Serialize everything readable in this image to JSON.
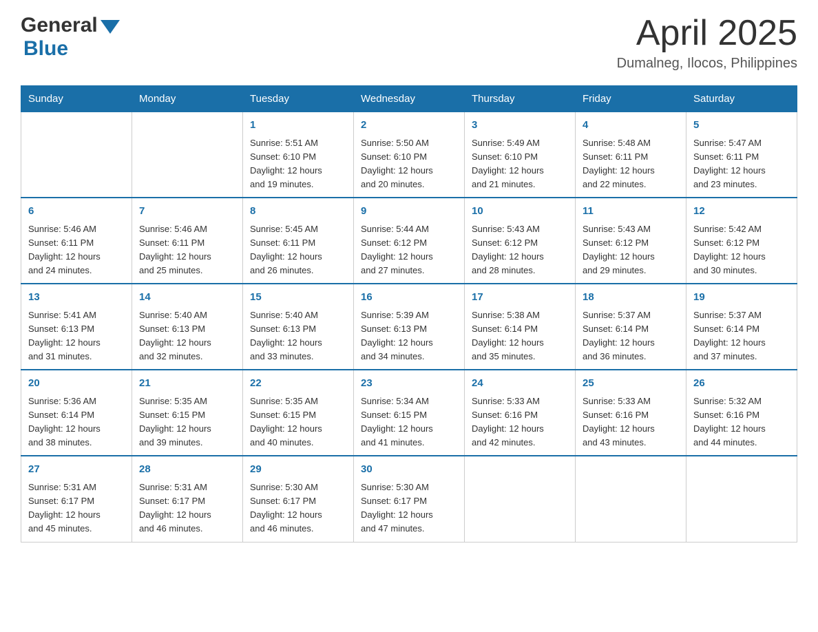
{
  "logo": {
    "part1": "General",
    "part2": "Blue"
  },
  "title": "April 2025",
  "subtitle": "Dumalneg, Ilocos, Philippines",
  "days_of_week": [
    "Sunday",
    "Monday",
    "Tuesday",
    "Wednesday",
    "Thursday",
    "Friday",
    "Saturday"
  ],
  "weeks": [
    [
      {
        "day": "",
        "info": ""
      },
      {
        "day": "",
        "info": ""
      },
      {
        "day": "1",
        "info": "Sunrise: 5:51 AM\nSunset: 6:10 PM\nDaylight: 12 hours\nand 19 minutes."
      },
      {
        "day": "2",
        "info": "Sunrise: 5:50 AM\nSunset: 6:10 PM\nDaylight: 12 hours\nand 20 minutes."
      },
      {
        "day": "3",
        "info": "Sunrise: 5:49 AM\nSunset: 6:10 PM\nDaylight: 12 hours\nand 21 minutes."
      },
      {
        "day": "4",
        "info": "Sunrise: 5:48 AM\nSunset: 6:11 PM\nDaylight: 12 hours\nand 22 minutes."
      },
      {
        "day": "5",
        "info": "Sunrise: 5:47 AM\nSunset: 6:11 PM\nDaylight: 12 hours\nand 23 minutes."
      }
    ],
    [
      {
        "day": "6",
        "info": "Sunrise: 5:46 AM\nSunset: 6:11 PM\nDaylight: 12 hours\nand 24 minutes."
      },
      {
        "day": "7",
        "info": "Sunrise: 5:46 AM\nSunset: 6:11 PM\nDaylight: 12 hours\nand 25 minutes."
      },
      {
        "day": "8",
        "info": "Sunrise: 5:45 AM\nSunset: 6:11 PM\nDaylight: 12 hours\nand 26 minutes."
      },
      {
        "day": "9",
        "info": "Sunrise: 5:44 AM\nSunset: 6:12 PM\nDaylight: 12 hours\nand 27 minutes."
      },
      {
        "day": "10",
        "info": "Sunrise: 5:43 AM\nSunset: 6:12 PM\nDaylight: 12 hours\nand 28 minutes."
      },
      {
        "day": "11",
        "info": "Sunrise: 5:43 AM\nSunset: 6:12 PM\nDaylight: 12 hours\nand 29 minutes."
      },
      {
        "day": "12",
        "info": "Sunrise: 5:42 AM\nSunset: 6:12 PM\nDaylight: 12 hours\nand 30 minutes."
      }
    ],
    [
      {
        "day": "13",
        "info": "Sunrise: 5:41 AM\nSunset: 6:13 PM\nDaylight: 12 hours\nand 31 minutes."
      },
      {
        "day": "14",
        "info": "Sunrise: 5:40 AM\nSunset: 6:13 PM\nDaylight: 12 hours\nand 32 minutes."
      },
      {
        "day": "15",
        "info": "Sunrise: 5:40 AM\nSunset: 6:13 PM\nDaylight: 12 hours\nand 33 minutes."
      },
      {
        "day": "16",
        "info": "Sunrise: 5:39 AM\nSunset: 6:13 PM\nDaylight: 12 hours\nand 34 minutes."
      },
      {
        "day": "17",
        "info": "Sunrise: 5:38 AM\nSunset: 6:14 PM\nDaylight: 12 hours\nand 35 minutes."
      },
      {
        "day": "18",
        "info": "Sunrise: 5:37 AM\nSunset: 6:14 PM\nDaylight: 12 hours\nand 36 minutes."
      },
      {
        "day": "19",
        "info": "Sunrise: 5:37 AM\nSunset: 6:14 PM\nDaylight: 12 hours\nand 37 minutes."
      }
    ],
    [
      {
        "day": "20",
        "info": "Sunrise: 5:36 AM\nSunset: 6:14 PM\nDaylight: 12 hours\nand 38 minutes."
      },
      {
        "day": "21",
        "info": "Sunrise: 5:35 AM\nSunset: 6:15 PM\nDaylight: 12 hours\nand 39 minutes."
      },
      {
        "day": "22",
        "info": "Sunrise: 5:35 AM\nSunset: 6:15 PM\nDaylight: 12 hours\nand 40 minutes."
      },
      {
        "day": "23",
        "info": "Sunrise: 5:34 AM\nSunset: 6:15 PM\nDaylight: 12 hours\nand 41 minutes."
      },
      {
        "day": "24",
        "info": "Sunrise: 5:33 AM\nSunset: 6:16 PM\nDaylight: 12 hours\nand 42 minutes."
      },
      {
        "day": "25",
        "info": "Sunrise: 5:33 AM\nSunset: 6:16 PM\nDaylight: 12 hours\nand 43 minutes."
      },
      {
        "day": "26",
        "info": "Sunrise: 5:32 AM\nSunset: 6:16 PM\nDaylight: 12 hours\nand 44 minutes."
      }
    ],
    [
      {
        "day": "27",
        "info": "Sunrise: 5:31 AM\nSunset: 6:17 PM\nDaylight: 12 hours\nand 45 minutes."
      },
      {
        "day": "28",
        "info": "Sunrise: 5:31 AM\nSunset: 6:17 PM\nDaylight: 12 hours\nand 46 minutes."
      },
      {
        "day": "29",
        "info": "Sunrise: 5:30 AM\nSunset: 6:17 PM\nDaylight: 12 hours\nand 46 minutes."
      },
      {
        "day": "30",
        "info": "Sunrise: 5:30 AM\nSunset: 6:17 PM\nDaylight: 12 hours\nand 47 minutes."
      },
      {
        "day": "",
        "info": ""
      },
      {
        "day": "",
        "info": ""
      },
      {
        "day": "",
        "info": ""
      }
    ]
  ]
}
